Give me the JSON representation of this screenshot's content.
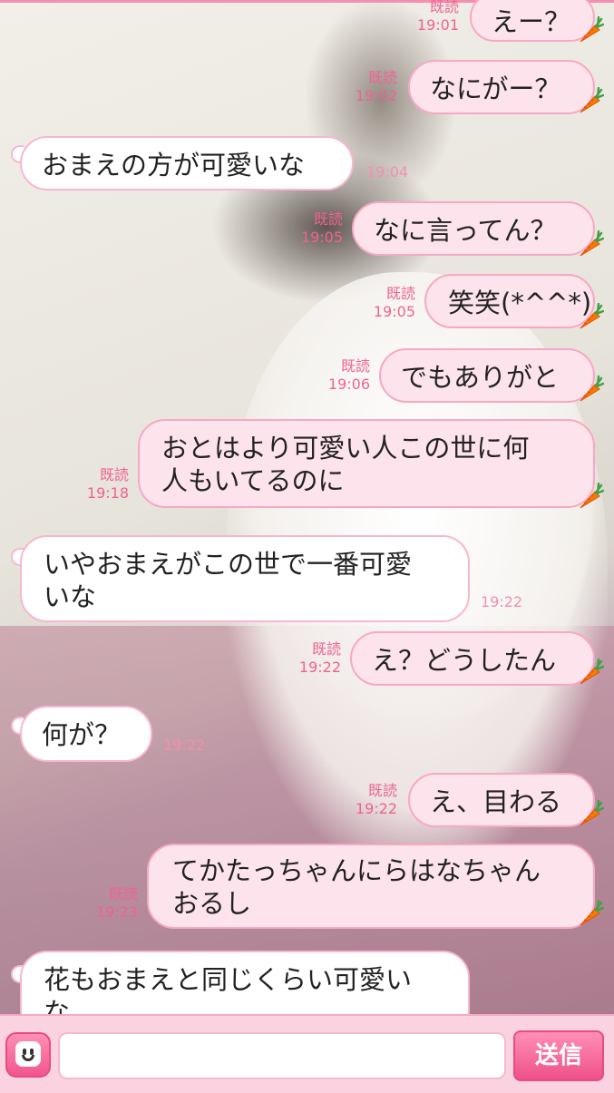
{
  "messages": [
    {
      "side": "out",
      "text": "えー？",
      "read": "既読",
      "time": "19:01"
    },
    {
      "side": "out",
      "text": "なにがー？",
      "read": "既読",
      "time": "19:02"
    },
    {
      "side": "in",
      "text": "おまえの方が可愛いな",
      "time": "19:04"
    },
    {
      "side": "out",
      "text": "なに言ってん？",
      "read": "既読",
      "time": "19:05"
    },
    {
      "side": "out",
      "text": "笑笑(*^^*)",
      "read": "既読",
      "time": "19:05"
    },
    {
      "side": "out",
      "text": "でもありがと",
      "read": "既読",
      "time": "19:06"
    },
    {
      "side": "out",
      "text": "おとはより可愛い人この世に何人もいてるのに",
      "line1": "おとはより可愛い人この世に何",
      "line2": "人もいてるのに",
      "read": "既読",
      "time": "19:18"
    },
    {
      "side": "in",
      "text": "いやおまえがこの世で一番可愛いな",
      "line1": "いやおまえがこの世で一番可愛",
      "line2": "いな",
      "time": "19:22"
    },
    {
      "side": "out",
      "text": "え？どうしたん",
      "read": "既読",
      "time": "19:22"
    },
    {
      "side": "in",
      "text": "何が？",
      "time": "19:22"
    },
    {
      "side": "out",
      "text": "え、目わる",
      "read": "既読",
      "time": "19:22"
    },
    {
      "side": "out",
      "text": "てかたっちゃんにらはなちゃんおるし",
      "line1": "てかたっちゃんにらはなちゃん",
      "line2": "おるし",
      "read": "既読",
      "time": "19:23"
    },
    {
      "side": "in",
      "text": "花もおまえと同じくらい可愛いな",
      "line1": "花もおまえと同じくらい可愛い",
      "line2": "な"
    }
  ],
  "input": {
    "placeholder": "",
    "value": ""
  },
  "send_label": "送信",
  "icons": {
    "emoji": "smiley-face-icon",
    "sticker": "carrot-icon"
  },
  "colors": {
    "accent": "#f06292",
    "bubble_out": "#fde3ec",
    "bubble_in": "#ffffff",
    "border": "#f7a8c4"
  }
}
